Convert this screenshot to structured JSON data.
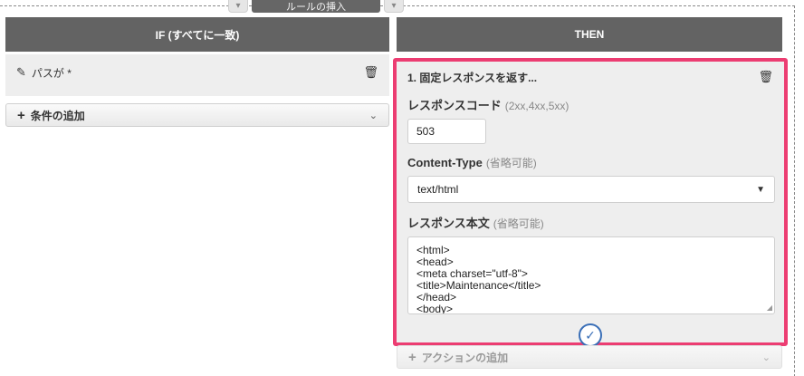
{
  "insert_bar": {
    "label": "ルールの挿入"
  },
  "if_column": {
    "header": "IF (すべてに一致)",
    "condition_text": "パスが *",
    "add_condition_label": "条件の追加"
  },
  "then_column": {
    "header": "THEN",
    "action": {
      "title": "1. 固定レスポンスを返す...",
      "response_code": {
        "label": "レスポンスコード",
        "hint": "(2xx,4xx,5xx)",
        "value": "503"
      },
      "content_type": {
        "label": "Content-Type",
        "hint": "(省略可能)",
        "value": "text/html"
      },
      "response_body": {
        "label": "レスポンス本文",
        "hint": "(省略可能)",
        "lines": [
          "<html>",
          "<head>",
          "<meta charset=\"utf-8\">",
          "<title>Maintenance</title>",
          "</head>",
          "<body>"
        ]
      }
    },
    "add_action_label": "アクションの追加"
  },
  "colors": {
    "header_bg": "#636363",
    "highlight": "#ec3d72",
    "confirm": "#3a6fb7"
  },
  "icons": {
    "pencil": "pencil-icon",
    "trash": "trash-icon",
    "plus": "plus-icon",
    "chevron": "chevron-down-icon",
    "check": "check-circle-icon"
  }
}
